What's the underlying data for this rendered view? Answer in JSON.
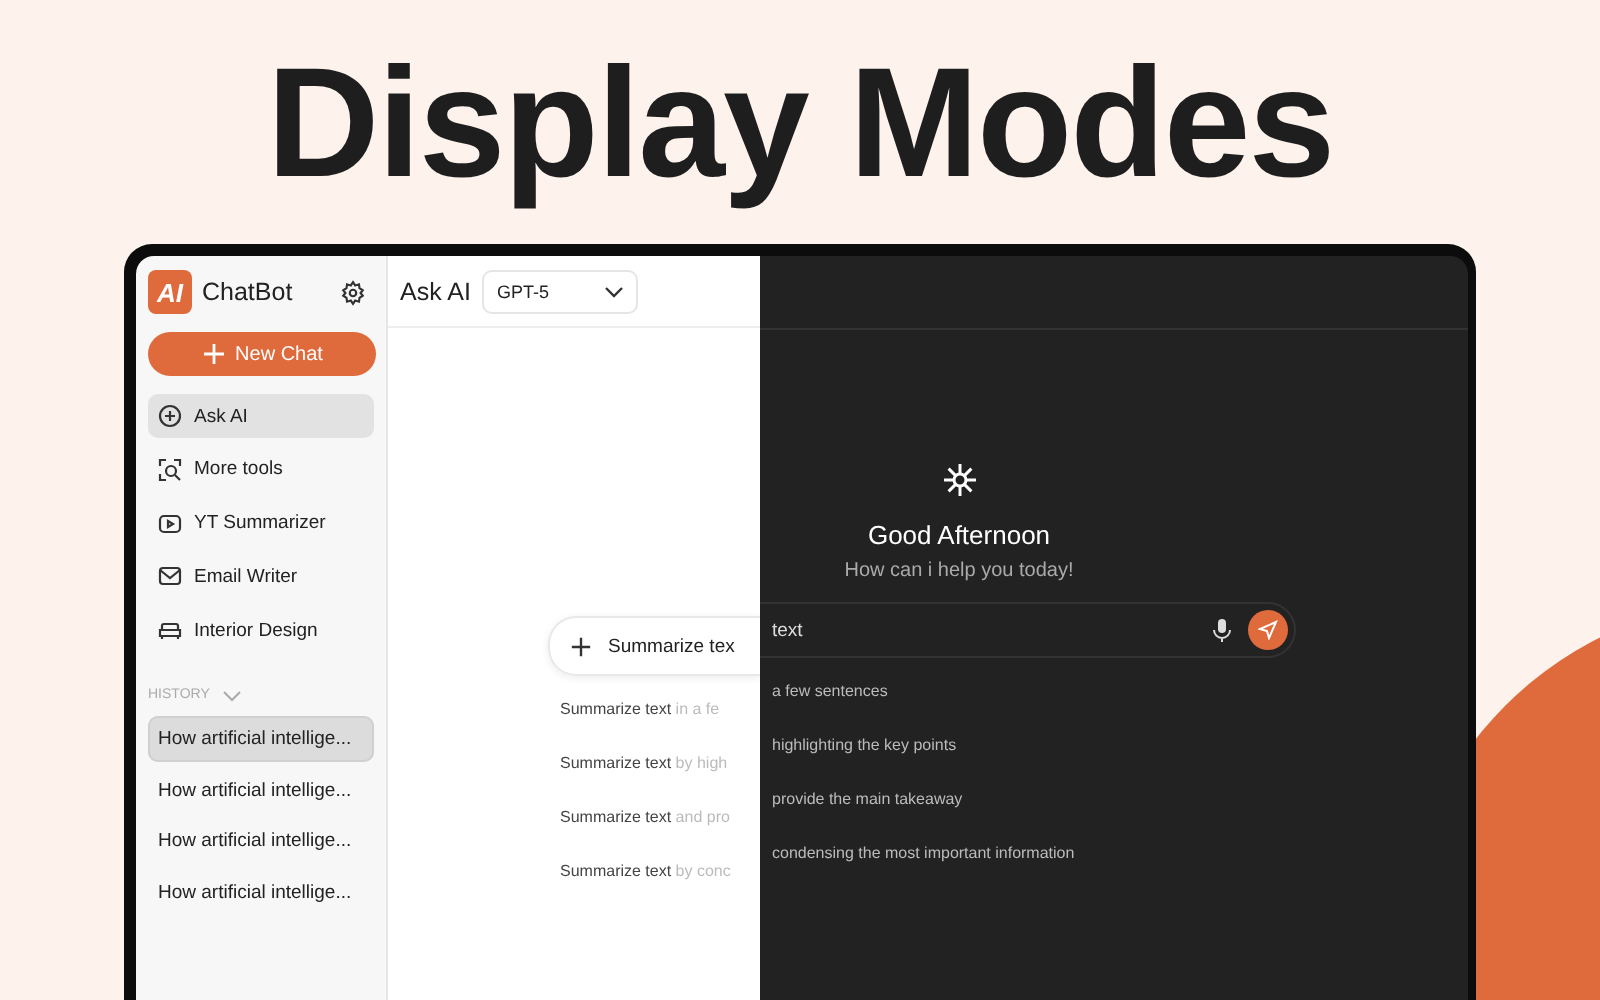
{
  "headline": "Display Modes",
  "sidebar": {
    "logo_text": "AI",
    "app_name": "ChatBot",
    "new_chat": "New Chat",
    "items": [
      {
        "label": "Ask AI",
        "selected": true
      },
      {
        "label": "More tools",
        "selected": false
      },
      {
        "label": "YT Summarizer",
        "selected": false
      },
      {
        "label": "Email Writer",
        "selected": false
      },
      {
        "label": "Interior Design",
        "selected": false
      }
    ],
    "history_label": "HISTORY",
    "history": [
      {
        "label": "How artificial intellige...",
        "selected": true
      },
      {
        "label": "How artificial intellige...",
        "selected": false
      },
      {
        "label": "How artificial intellige...",
        "selected": false
      },
      {
        "label": "How artificial intellige...",
        "selected": false
      }
    ]
  },
  "light_pane": {
    "title": "Ask AI",
    "model": "GPT-5",
    "input_value": "Summarize tex",
    "suggestions": [
      {
        "lead": "Summarize text",
        "rest": "in a fe"
      },
      {
        "lead": "Summarize text",
        "rest": "by high"
      },
      {
        "lead": "Summarize text",
        "rest": "and pro"
      },
      {
        "lead": "Summarize text",
        "rest": "by conc"
      }
    ]
  },
  "dark_pane": {
    "greeting": "Good Afternoon",
    "subtitle": "How can i help you today!",
    "input_value": "text",
    "suggestions": [
      "a few sentences",
      "highlighting the key points",
      "provide the main takeaway",
      "condensing the most important information"
    ]
  }
}
